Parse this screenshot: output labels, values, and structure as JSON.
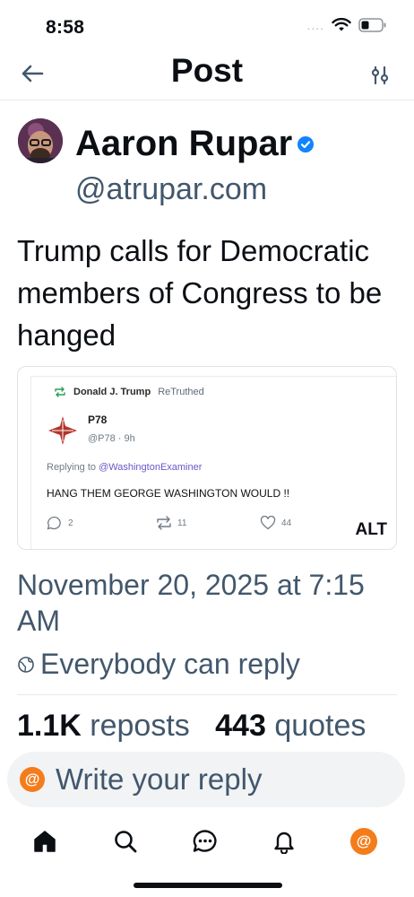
{
  "status_bar": {
    "time": "8:58",
    "signal_dots": "....",
    "wifi_icon": "wifi-icon",
    "battery_icon": "battery-icon",
    "battery_level": 0.3
  },
  "header": {
    "title": "Post",
    "back_icon": "arrow-left-icon",
    "filter_icon": "sliders-icon"
  },
  "author": {
    "name": "Aaron Rupar",
    "handle": "@atrupar.com",
    "verified": true
  },
  "post": {
    "text": "Trump calls for Democratic members of Congress to be hanged",
    "date": "November 20, 2025 at 7:15 AM",
    "reply_setting": "Everybody can reply"
  },
  "embed": {
    "retruthed_by": "Donald J. Trump",
    "retruth_verb": "ReTruthed",
    "name": "P78",
    "handle_time": "@P78 · 9h",
    "replying_prefix": "Replying to ",
    "replying_to": "@WashingtonExaminer",
    "body": "HANG THEM GEORGE WASHINGTON WOULD !!",
    "replies": "2",
    "retruths": "11",
    "likes": "44",
    "alt_badge": "ALT"
  },
  "stats": {
    "reposts_count": "1.1K",
    "reposts_label": "reposts",
    "quotes_count": "443",
    "quotes_label": "quotes"
  },
  "composer": {
    "placeholder": "Write your reply",
    "avatar_glyph": "@"
  },
  "tabbar": {
    "items": [
      {
        "name": "home-icon"
      },
      {
        "name": "search-icon"
      },
      {
        "name": "chat-icon"
      },
      {
        "name": "bell-icon"
      },
      {
        "name": "profile-avatar",
        "glyph": "@"
      }
    ]
  },
  "colors": {
    "accent": "#1083fe",
    "muted_text": "#42576c",
    "avatar_orange": "#f47c1b",
    "truth_link": "#6a58c9"
  }
}
